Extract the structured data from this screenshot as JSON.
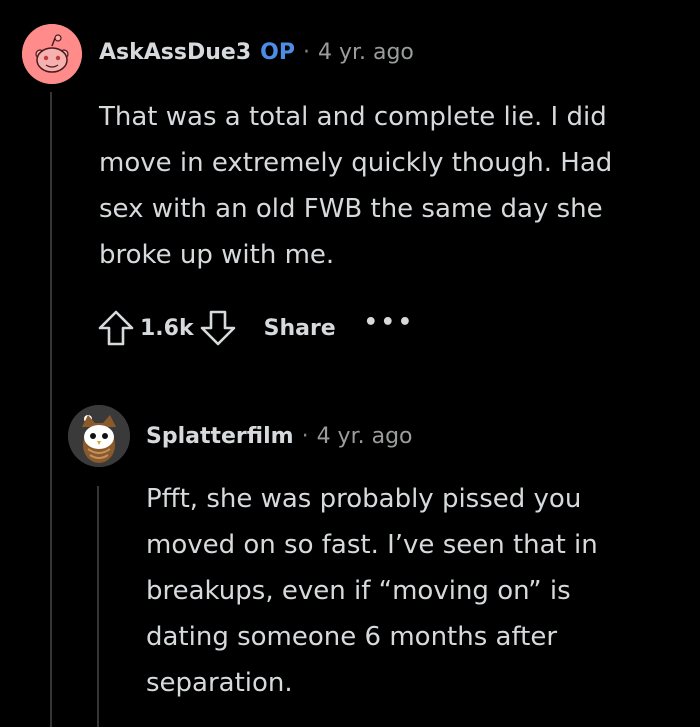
{
  "comment": {
    "author": "AskAssDue3",
    "badge": "OP",
    "separator": "·",
    "age": "4 yr. ago",
    "lines": [
      "That was a total and complete lie. I did",
      "move in extremely quickly though. Had",
      "sex with an old FWB the same day she",
      "broke up with me."
    ],
    "score": "1.6k",
    "share_label": "Share",
    "more_label": "•••",
    "avatar_icon": "reddit-snoo-avatar"
  },
  "reply": {
    "author": "Splatterfilm",
    "separator": "·",
    "age": "4 yr. ago",
    "lines": [
      "Pfft, she was probably pissed you",
      "moved on so fast. I’ve seen that in",
      "breakups, even if “moving on” is",
      "dating someone 6 months after",
      "separation."
    ],
    "avatar_icon": "owl-avatar"
  },
  "colors": {
    "background": "#000000",
    "text": "#d7dadc",
    "muted": "#9a9c9d",
    "op_badge": "#4a8ee8",
    "thread_line": "#343536",
    "avatar_pink": "#ff8b8b"
  }
}
